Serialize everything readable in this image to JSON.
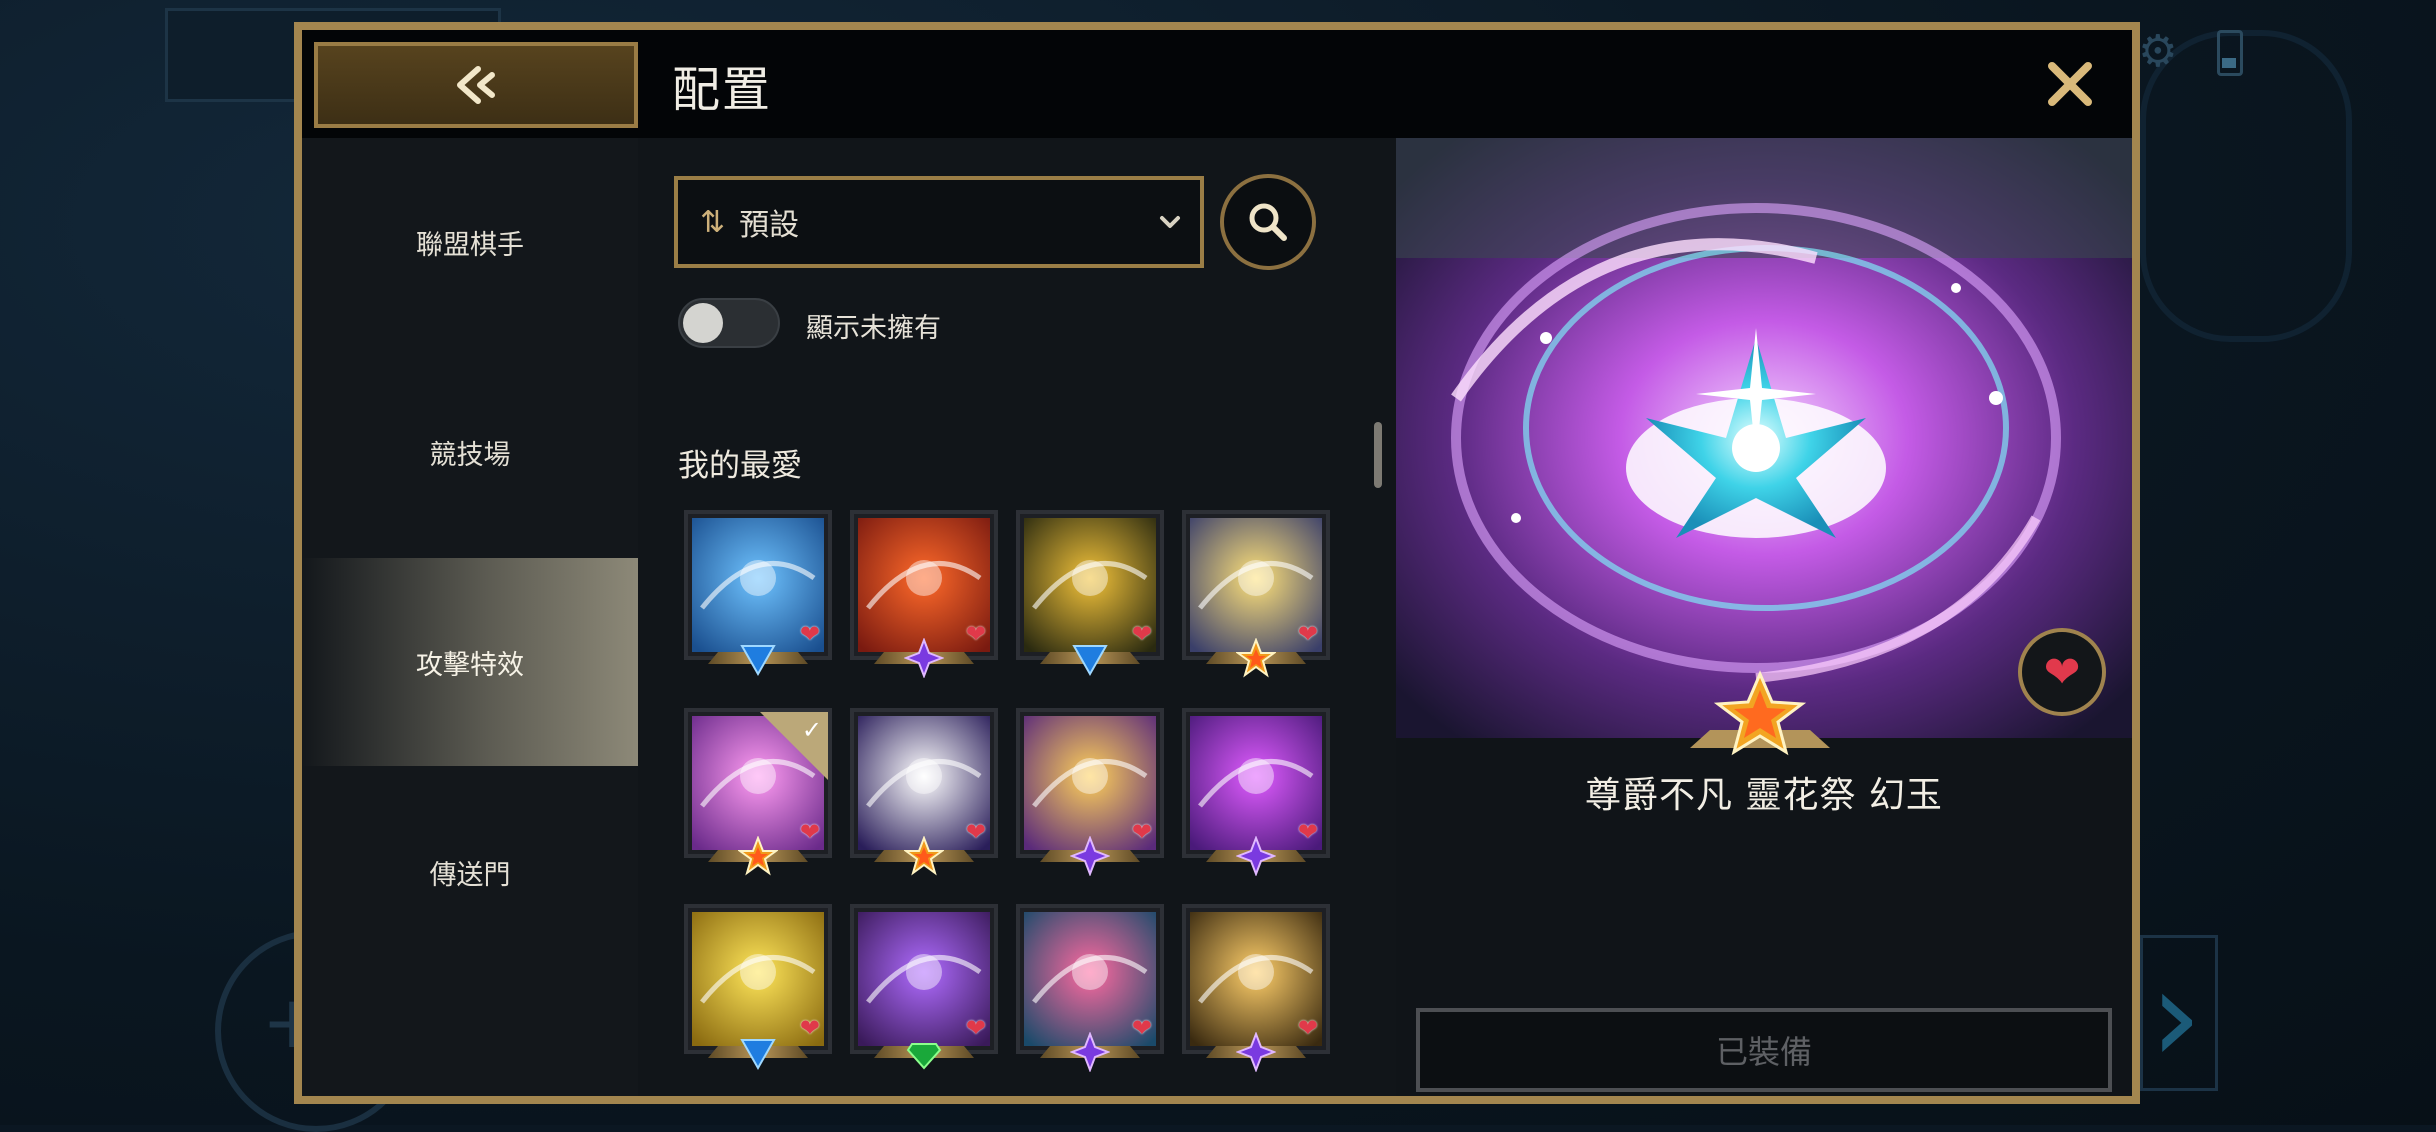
{
  "header": {
    "title": "配置",
    "back_icon": "back-arrow-icon",
    "close_icon": "close-icon"
  },
  "sidebar": {
    "items": [
      {
        "label": "聯盟棋手",
        "active": false
      },
      {
        "label": "競技場",
        "active": false
      },
      {
        "label": "攻擊特效",
        "active": true
      },
      {
        "label": "傳送門",
        "active": false
      }
    ]
  },
  "filters": {
    "sort_icon": "sort-arrows-icon",
    "sort_label": "預設",
    "search_icon": "search-icon",
    "toggle_label": "顯示未擁有",
    "toggle_on": false
  },
  "section": {
    "title": "我的最愛"
  },
  "tiles": [
    {
      "gem": "blue",
      "favorite": true,
      "equipped": false
    },
    {
      "gem": "purple",
      "favorite": true,
      "equipped": false
    },
    {
      "gem": "blue",
      "favorite": true,
      "equipped": false
    },
    {
      "gem": "orange",
      "favorite": true,
      "equipped": false
    },
    {
      "gem": "orange",
      "favorite": true,
      "equipped": true
    },
    {
      "gem": "orange",
      "favorite": true,
      "equipped": false
    },
    {
      "gem": "purple",
      "favorite": true,
      "equipped": false
    },
    {
      "gem": "purple",
      "favorite": true,
      "equipped": false
    },
    {
      "gem": "blue",
      "favorite": true,
      "equipped": false
    },
    {
      "gem": "green",
      "favorite": true,
      "equipped": false
    },
    {
      "gem": "purple",
      "favorite": true,
      "equipped": false
    },
    {
      "gem": "purple",
      "favorite": true,
      "equipped": false
    }
  ],
  "preview": {
    "name": "尊爵不凡 靈花祭 幻玉",
    "favorite_icon": "heart-icon",
    "rarity_icon": "star-gem-icon",
    "equip_label": "已裝備"
  },
  "colors": {
    "gold_border": "#a3864f",
    "heart": "#e0394a"
  }
}
